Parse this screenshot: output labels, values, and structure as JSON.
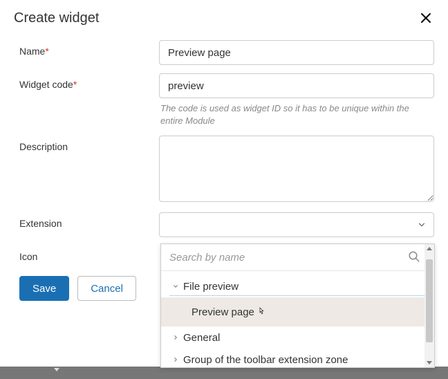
{
  "header": {
    "title": "Create widget"
  },
  "fields": {
    "name": {
      "label": "Name",
      "required": true,
      "value": "Preview page"
    },
    "widget_code": {
      "label": "Widget code",
      "required": true,
      "value": "preview",
      "hint": "The code is used as widget ID so it has to be unique within the entire Module"
    },
    "description": {
      "label": "Description",
      "value": ""
    },
    "extension": {
      "label": "Extension",
      "value": ""
    },
    "icon": {
      "label": "Icon"
    }
  },
  "dropdown": {
    "search_placeholder": "Search by name",
    "groups": [
      {
        "label": "File preview",
        "expanded": true,
        "items": [
          {
            "label": "Preview page",
            "selected": true
          }
        ]
      },
      {
        "label": "General",
        "expanded": false
      },
      {
        "label": "Group of the toolbar extension zone",
        "expanded": false
      }
    ]
  },
  "buttons": {
    "save": "Save",
    "cancel": "Cancel"
  }
}
